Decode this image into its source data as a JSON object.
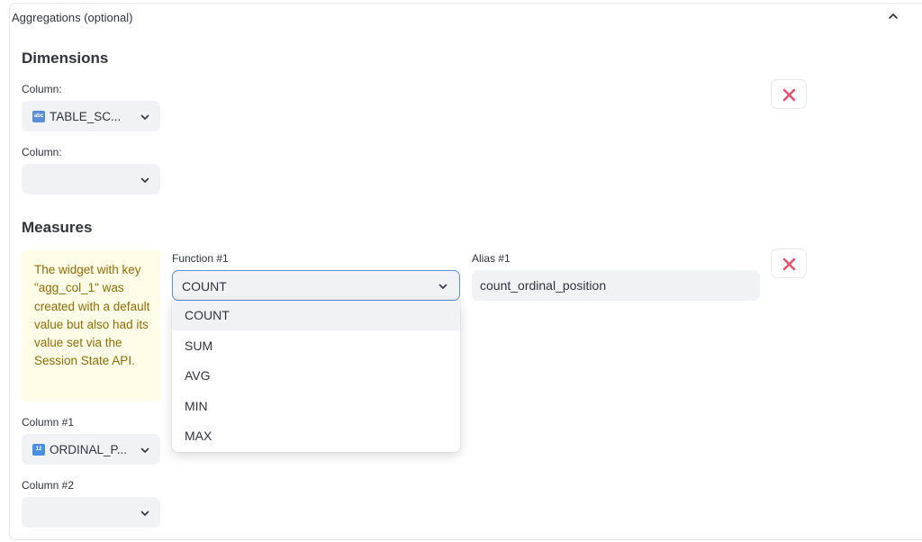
{
  "panel": {
    "title": "Aggregations (optional)"
  },
  "dimensions": {
    "title": "Dimensions",
    "rows": [
      {
        "label": "Column:",
        "value": "TABLE_SC...",
        "icon": "abc-text-icon"
      },
      {
        "label": "Column:",
        "value": ""
      }
    ]
  },
  "measures": {
    "title": "Measures",
    "warning": "The widget with key \"agg_col_1\" was created with a default value but also had its value set via the Session State API.",
    "function_label": "Function #1",
    "function_value": "COUNT",
    "alias_label": "Alias #1",
    "alias_value": "count_ordinal_position",
    "function_options": [
      "COUNT",
      "SUM",
      "AVG",
      "MIN",
      "MAX"
    ],
    "column1_label": "Column #1",
    "column1_value": "ORDINAL_P...",
    "column1_icon": "numeric-column-icon",
    "column2_label": "Column #2",
    "column2_value": ""
  },
  "colors": {
    "delete": "#e8516e",
    "warning_bg": "#fffce7",
    "warning_text": "#926c05",
    "focus_border": "#5a8fd8"
  }
}
